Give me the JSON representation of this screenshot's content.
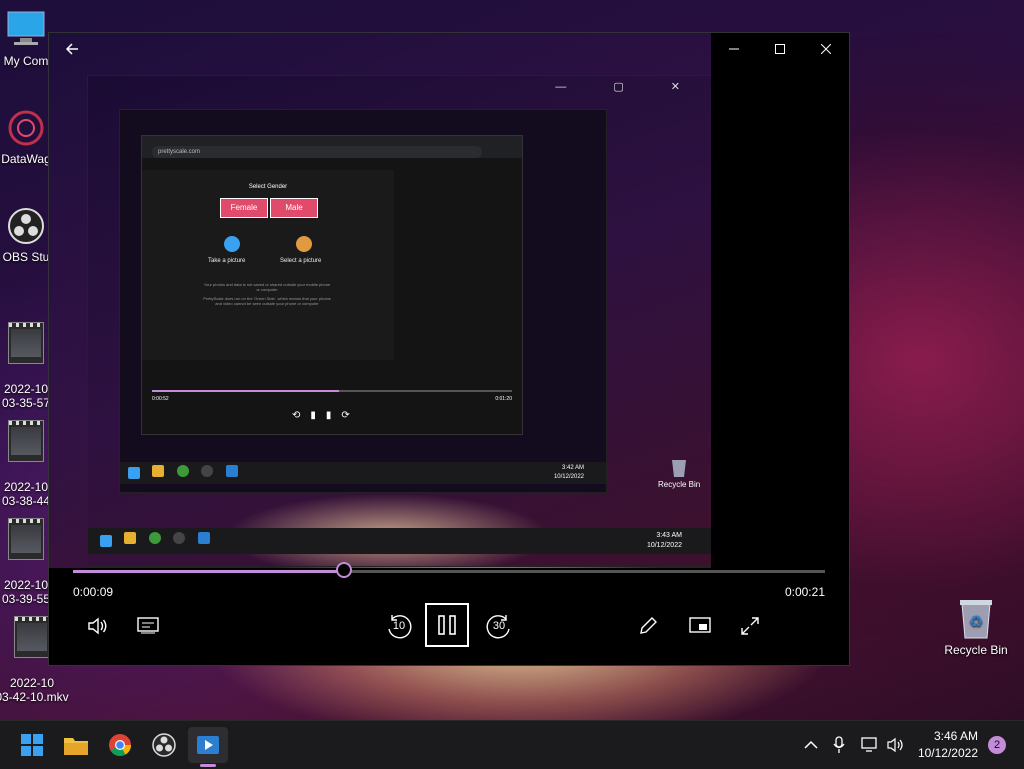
{
  "desktop": {
    "icons_left": [
      {
        "label": "My Com",
        "icon": "computer-icon"
      },
      {
        "label": "DataWag",
        "icon": "datawag-icon"
      },
      {
        "label": "OBS Stu",
        "icon": "obs-icon"
      },
      {
        "label": "2022-10\n03-35-57",
        "icon": "video-file-icon"
      },
      {
        "label": "2022-10\n03-38-44",
        "icon": "video-file-icon"
      },
      {
        "label": "2022-10\n03-39-55",
        "icon": "video-file-icon"
      },
      {
        "label": "2022-10\n03-42-10.mkv",
        "icon": "video-file-icon"
      }
    ],
    "recycle_bin": {
      "label": "Recycle Bin",
      "icon": "recycle-bin-icon"
    }
  },
  "player": {
    "back_icon": "arrow-left-icon",
    "window_controls": [
      "minimize-icon",
      "maximize-icon",
      "close-icon"
    ],
    "current_time": "0:00:09",
    "total_time": "0:00:21",
    "progress_fraction": 0.36,
    "controls": {
      "volume_icon": "volume-icon",
      "captions_icon": "captions-icon",
      "rewind_label": "10",
      "forward_label": "30",
      "play_state": "playing",
      "edit_icon": "pencil-icon",
      "miniplayer_icon": "miniplayer-icon",
      "fullscreen_icon": "fullscreen-icon"
    },
    "video_frame": {
      "recursive_clock": "3:43 AM",
      "recursive_date": "10/12/2022",
      "inner_clock": "3:42 AM",
      "inner_date": "10/12/2022",
      "inner_time_start": "0:00:52",
      "inner_time_end": "0:01:20",
      "recycle_label": "Recycle Bin",
      "browser_url": "prettyscale.com",
      "select_gender": "Select Gender",
      "female": "Female",
      "male": "Male",
      "take_picture": "Take a picture",
      "select_picture": "Select a picture",
      "note1": "Your photos and data is not saved or shared outside your mobile phone or computer",
      "note2": "PrettyScale does run on the 'Green Side', which means that your photos and video cannot be seen outside your phone or computer"
    }
  },
  "taskbar": {
    "apps": [
      {
        "name": "start",
        "icon": "windows-start-icon"
      },
      {
        "name": "file-explorer",
        "icon": "folder-icon"
      },
      {
        "name": "chrome",
        "icon": "chrome-icon"
      },
      {
        "name": "obs",
        "icon": "obs-icon"
      },
      {
        "name": "media-player",
        "icon": "media-player-icon",
        "active": true
      }
    ],
    "tray_icons": [
      "chevron-up-icon",
      "microphone-icon",
      "network-icon",
      "volume-icon"
    ],
    "clock_time": "3:46 AM",
    "clock_date": "10/12/2022",
    "notification_count": "2"
  },
  "colors": {
    "accent": "#c38bd8",
    "taskbar": "#1b1b1d"
  }
}
